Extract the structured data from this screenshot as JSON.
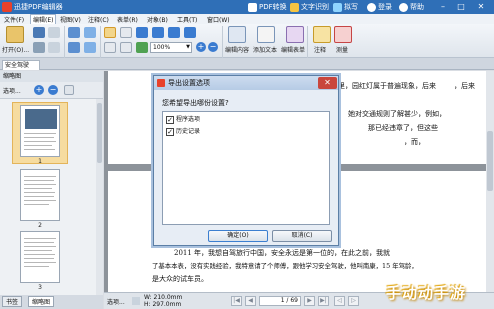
{
  "app": {
    "title": "迅捷PDF编辑器"
  },
  "menu": [
    "文件(F)",
    "编辑(E)",
    "视图(V)",
    "注释(C)",
    "表单(R)",
    "对象(B)",
    "工具(T)",
    "窗口(W)"
  ],
  "title_buttons": {
    "pdf_convert": "PDF转换",
    "ocr": "文字识别",
    "screenshot": "拟写",
    "login": "登录",
    "help": "帮助"
  },
  "ribbon": {
    "open": "打开(O)...",
    "zoom": "100%",
    "edit_content": "编辑内容",
    "add_text": "添加文本",
    "edit_form": "编辑表单",
    "annotate": "注释",
    "measure": "测量"
  },
  "doc_tab": "安全驾驶",
  "left_panel": {
    "header": "缩略图",
    "tool_label": "选项...",
    "pages": [
      "1",
      "2",
      "3"
    ]
  },
  "bottom_tabs": [
    "书签",
    "缩略图"
  ],
  "document": {
    "page1_lines": [
      "，后来",
      "里，园红灯属于普遍现象，后来",
      "她对交通规则了解甚少，例如，",
      "那已经违章了，但这些",
      "，而，"
    ],
    "page2_lines": [
      "2011 年，我想自驾旅行中国，安全永远是第一位的，在此之前，我就",
      "了基本本表，没有实践经验，我特意请了个师傅，跟他学习安全驾驶，他叫南康，15 年驾龄，",
      "是大众的试车员。"
    ]
  },
  "status": {
    "options": "选项...",
    "width": "W: 210.0mm",
    "height": "H: 297.0mm",
    "page": "1 / 69"
  },
  "dialog": {
    "title": "导出设置选项",
    "question": "您希望导出哪份设置?",
    "options": [
      "程序选项",
      "历史记录"
    ],
    "ok": "确定(O)",
    "cancel": "取消(C)",
    "close": "✕"
  },
  "watermark": "手动动手游",
  "colors": {
    "titlebar": "#2f6fb7",
    "accent": "#3a7bd0"
  }
}
